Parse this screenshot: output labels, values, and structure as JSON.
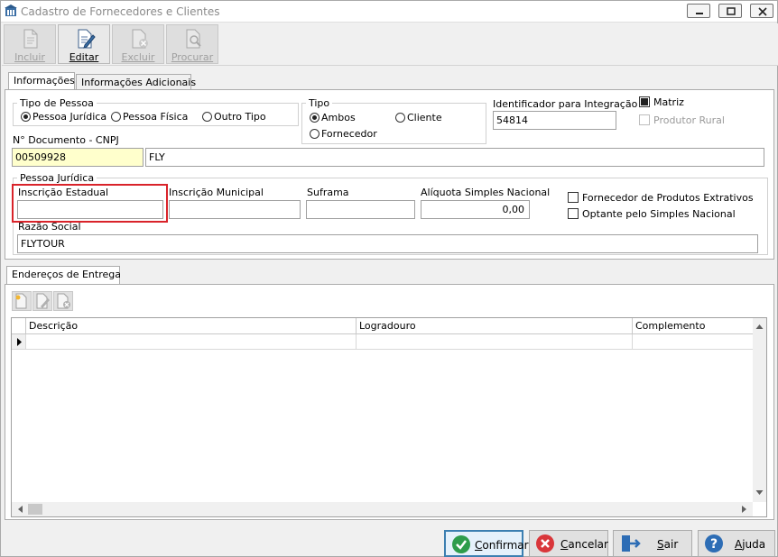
{
  "window": {
    "title": "Cadastro de Fornecedores e Clientes"
  },
  "toolbar": {
    "incluir": "Incluir",
    "editar": "Editar",
    "excluir": "Excluir",
    "procurar": "Procurar"
  },
  "tabs": {
    "informacoes": "Informações",
    "adicionais": "Informações Adicionais"
  },
  "tipo_pessoa": {
    "legend": "Tipo de Pessoa",
    "juridica": "Pessoa Jurídica",
    "fisica": "Pessoa Física",
    "outro": "Outro Tipo",
    "selected": "Pessoa Jurídica"
  },
  "tipo": {
    "legend": "Tipo",
    "ambos": "Ambos",
    "cliente": "Cliente",
    "fornecedor": "Fornecedor",
    "selected": "Ambos"
  },
  "integracao": {
    "label": "Identificador para Integração",
    "value": "54814"
  },
  "matriz": {
    "label": "Matriz",
    "checked": true
  },
  "produtor_rural": {
    "label": "Produtor Rural",
    "checked": false,
    "disabled": true
  },
  "documento": {
    "label": "N° Documento - CNPJ",
    "value": "00509928",
    "name": "FLY"
  },
  "pj": {
    "legend": "Pessoa Jurídica",
    "inscricao_estadual": {
      "label": "Inscrição Estadual",
      "value": ""
    },
    "inscricao_municipal": {
      "label": "Inscrição Municipal",
      "value": ""
    },
    "suframa": {
      "label": "Suframa",
      "value": ""
    },
    "aliquota": {
      "label": "Alíquota Simples Nacional",
      "value": "0,00"
    },
    "extrativos": {
      "label": "Fornecedor de Produtos Extrativos",
      "checked": false
    },
    "simples": {
      "label": "Optante pelo Simples Nacional",
      "checked": false
    },
    "razao_social": {
      "label": "Razão Social",
      "value": "FLYTOUR"
    }
  },
  "enderecos": {
    "tab": "Endereços de Entrega",
    "columns": [
      "Descrição",
      "Logradouro",
      "Complemento"
    ]
  },
  "buttons": {
    "confirmar": "Confirmar",
    "cancelar": "Cancelar",
    "sair": "Sair",
    "ajuda": "Ajuda"
  },
  "colors": {
    "accent": "#3c7fb1",
    "highlight": "#d9232a",
    "cancel": "#d9363a",
    "confirm": "#2e9c4b",
    "help": "#2d6db5"
  }
}
